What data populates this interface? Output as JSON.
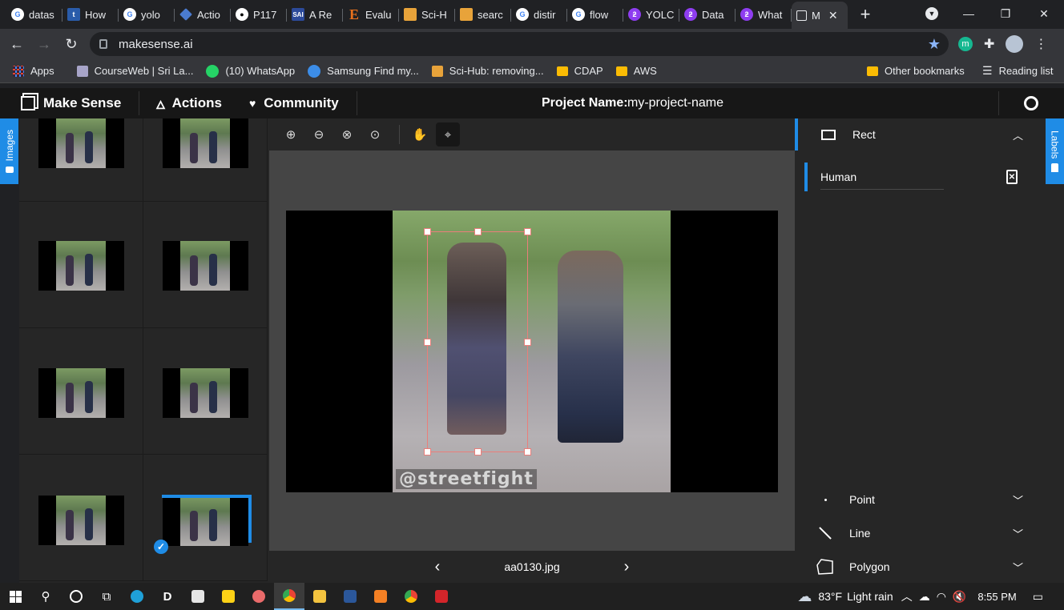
{
  "browser": {
    "tabs": [
      {
        "label": "datas",
        "icon": "google-icon"
      },
      {
        "label": "How",
        "icon": "tds-icon"
      },
      {
        "label": "yolo",
        "icon": "google-icon"
      },
      {
        "label": "Actio",
        "icon": "diamond-icon"
      },
      {
        "label": "P117",
        "icon": "github-icon"
      },
      {
        "label": "A Re",
        "icon": "sai-icon"
      },
      {
        "label": "Evalu",
        "icon": "e-icon"
      },
      {
        "label": "Sci-H",
        "icon": "scihub-icon"
      },
      {
        "label": "searc",
        "icon": "scihub-icon"
      },
      {
        "label": "distir",
        "icon": "google-icon"
      },
      {
        "label": "flow",
        "icon": "google-icon"
      },
      {
        "label": "YOLC",
        "icon": "roboflow-icon"
      },
      {
        "label": "Data",
        "icon": "roboflow-icon"
      },
      {
        "label": "What",
        "icon": "roboflow-icon"
      },
      {
        "label": "M",
        "icon": "makesense-icon"
      }
    ],
    "url": "makesense.ai",
    "bookmarks": [
      {
        "label": "Apps",
        "icon": "apps-grid-icon"
      },
      {
        "label": "CourseWeb | Sri La...",
        "icon": "courseweb-icon"
      },
      {
        "label": "(10) WhatsApp",
        "icon": "whatsapp-icon"
      },
      {
        "label": "Samsung Find my...",
        "icon": "samsung-icon"
      },
      {
        "label": "Sci-Hub: removing...",
        "icon": "scihub-icon"
      },
      {
        "label": "CDAP",
        "icon": "folder-icon"
      },
      {
        "label": "AWS",
        "icon": "folder-icon"
      }
    ],
    "other_bookmarks": "Other bookmarks",
    "reading_list": "Reading list"
  },
  "app": {
    "brand": "Make Sense",
    "actions": "Actions",
    "community": "Community",
    "project_name_label": "Project Name:",
    "project_name_value": "my-project-name",
    "left_tab": "Images",
    "right_tab": "Labels",
    "filename": "aa0130.jpg",
    "watermark": "@streetfight",
    "label_types": [
      {
        "label": "Rect",
        "icon": "rect-icon",
        "expanded": true
      },
      {
        "label": "Point",
        "icon": "point-icon",
        "expanded": false
      },
      {
        "label": "Line",
        "icon": "line-icon",
        "expanded": false
      },
      {
        "label": "Polygon",
        "icon": "polygon-icon",
        "expanded": false
      }
    ],
    "rect_labels": [
      "Human"
    ]
  },
  "taskbar": {
    "weather_temp": "83°F",
    "weather_desc": "Light rain",
    "time": "8:55 PM"
  },
  "colors": {
    "accent": "#1f8ce6",
    "bbox": "#ea7e7a",
    "panel": "#262626",
    "topbar": "#171717"
  }
}
